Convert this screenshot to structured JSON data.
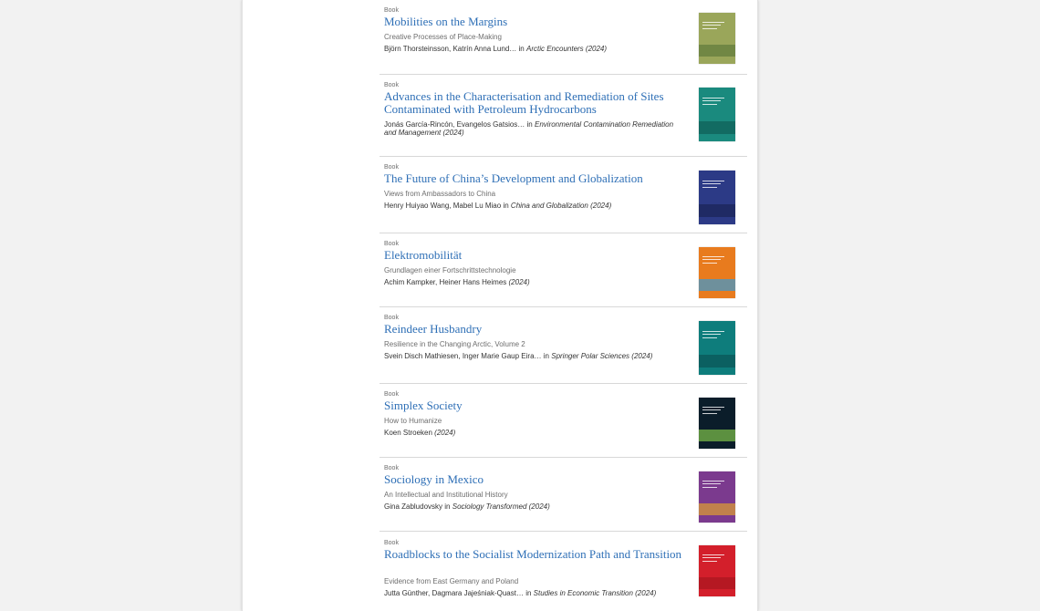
{
  "results": [
    {
      "type": "Book",
      "title": "Mobilities on the Margins",
      "subtitle": "Creative Processes of Place-Making",
      "authors": "Björn Thorsteinsson, Katrín Anna Lund…",
      "in": "in",
      "series": "Arctic Encounters",
      "year": "(2024)",
      "cover_color": "#9aa65a",
      "cover_accent": "#5f7a3a"
    },
    {
      "type": "Book",
      "title": "Advances in the Characterisation and Remediation of Sites Contaminated with Petroleum Hydrocarbons",
      "subtitle": "",
      "authors": "Jonás García-Rincón, Evangelos Gatsios…",
      "in": "in",
      "series": "Environmental Contamination Remediation and Management",
      "year": "(2024)",
      "cover_color": "#1a8a7e",
      "cover_accent": "#0f5e57"
    },
    {
      "type": "Book",
      "title": "The Future of China’s Development and Globalization",
      "subtitle": "Views from Ambassadors to China",
      "authors": "Henry Huiyao Wang, Mabel Lu Miao",
      "in": "in",
      "series": "China and Globalization",
      "year": "(2024)",
      "cover_color": "#2c3a86",
      "cover_accent": "#1a2356"
    },
    {
      "type": "Book",
      "title": "Elektromobilität",
      "subtitle": "Grundlagen einer Fortschrittstechnologie",
      "authors": "Achim Kampker, Heiner Hans Heimes",
      "in": "",
      "series": "",
      "year": "(2024)",
      "cover_color": "#e87b1e",
      "cover_accent": "#3a9ad2"
    },
    {
      "type": "Book",
      "title": "Reindeer Husbandry",
      "subtitle": "Resilience in the Changing Arctic, Volume 2",
      "authors": "Svein Disch Mathiesen, Inger Marie Gaup Eira…",
      "in": "in",
      "series": "Springer Polar Sciences",
      "year": "(2024)",
      "cover_color": "#0e7d7c",
      "cover_accent": "#0a5455"
    },
    {
      "type": "Book",
      "title": "Simplex Society",
      "subtitle": "How to Humanize",
      "authors": "Koen Stroeken",
      "in": "",
      "series": "",
      "year": "(2024)",
      "cover_color": "#0b1d2a",
      "cover_accent": "#7fc24a"
    },
    {
      "type": "Book",
      "title": "Sociology in Mexico",
      "subtitle": "An Intellectual and Institutional History",
      "authors": "Gina Zabludovsky",
      "in": "in",
      "series": "Sociology Transformed",
      "year": "(2024)",
      "cover_color": "#7b3a8e",
      "cover_accent": "#e0a030"
    },
    {
      "type": "Book",
      "title": "Roadblocks to the Socialist Modernization Path and Transition",
      "subtitle": "Evidence from East Germany and Poland",
      "authors": "Jutta Günther, Dagmara Jajeśniak-Quast…",
      "in": "in",
      "series": "Studies in Economic Transition",
      "year": "(2024)",
      "cover_color": "#d31f2b",
      "cover_accent": "#a81520"
    }
  ]
}
